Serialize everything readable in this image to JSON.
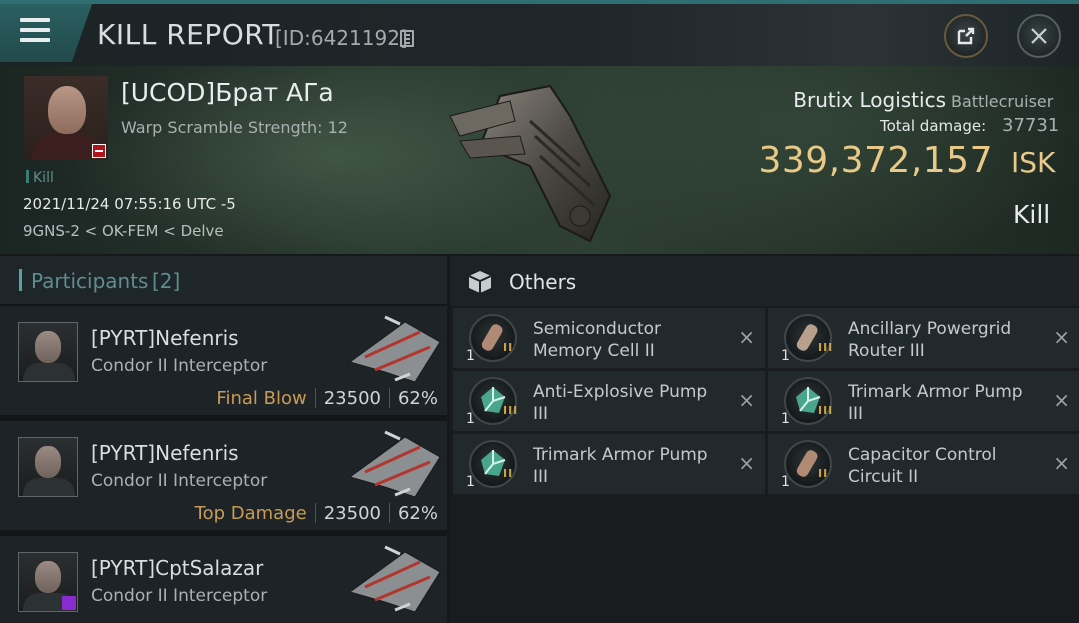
{
  "window": {
    "title": "KILL REPORT",
    "report_id": "[ID:6421192]"
  },
  "victim": {
    "name": "[UCOD]Брат АГа",
    "warp_scramble": "Warp Scramble Strength: 12",
    "tag": "Kill",
    "datetime": "2021/11/24 07:55:16 UTC -5",
    "location": "9GNS-2 < OK-FEM < Delve",
    "ship_name": "Brutix Logistics",
    "ship_class": "Battlecruiser",
    "total_damage_label": "Total damage:",
    "total_damage": "37731",
    "isk_value": "339,372,157",
    "isk_unit": "ISK",
    "result": "Kill"
  },
  "participants": {
    "label": "Participants",
    "count": "[2]",
    "rows": [
      {
        "name": "[PYRT]Nefenris",
        "ship": "Condor II Interceptor",
        "role": "Final Blow",
        "damage": "23500",
        "percent": "62%"
      },
      {
        "name": "[PYRT]Nefenris",
        "ship": "Condor II Interceptor",
        "role": "Top Damage",
        "damage": "23500",
        "percent": "62%"
      },
      {
        "name": "[PYRT]CptSalazar",
        "ship": "Condor II Interceptor"
      }
    ]
  },
  "others": {
    "label": "Others",
    "items": [
      {
        "qty": "1",
        "meta": "II",
        "name": "Semiconductor Memory Cell II",
        "icon": "memory-cell-icon",
        "close": "×"
      },
      {
        "qty": "1",
        "meta": "III",
        "name": "Ancillary Powergrid Router III",
        "icon": "powergrid-router-icon",
        "close": "×"
      },
      {
        "qty": "1",
        "meta": "III",
        "name": "Anti-Explosive Pump III",
        "icon": "armor-pump-icon",
        "close": "×"
      },
      {
        "qty": "1",
        "meta": "III",
        "name": "Trimark Armor Pump III",
        "icon": "armor-pump-icon",
        "close": "×"
      },
      {
        "qty": "1",
        "meta": "II",
        "name": "Trimark Armor Pump III",
        "icon": "armor-pump-icon",
        "close": "×"
      },
      {
        "qty": "1",
        "meta": "II",
        "name": "Capacitor Control Circuit II",
        "icon": "capacitor-circuit-icon",
        "close": "×"
      }
    ]
  },
  "colors": {
    "accent_teal": "#58a2a1",
    "isk_gold": "#e8c987",
    "final_blow": "#c89c56"
  }
}
